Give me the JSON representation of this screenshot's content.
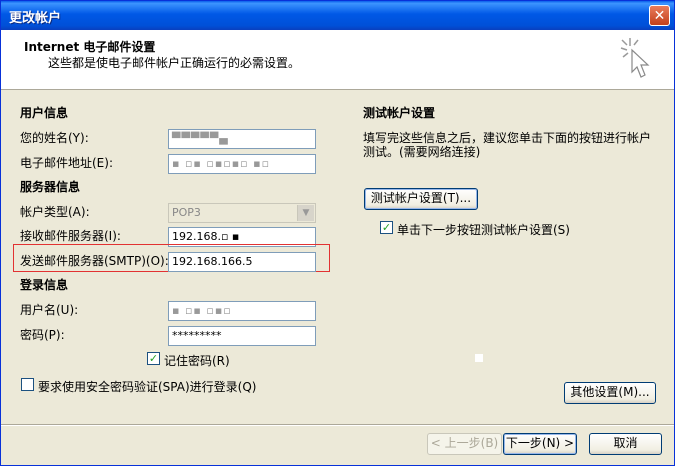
{
  "window": {
    "title": "更改帐户",
    "close_glyph": "✕"
  },
  "header": {
    "title": "Internet 电子邮件设置",
    "subtitle": "这些都是使电子邮件帐户正确运行的必需设置。"
  },
  "user_info": {
    "heading": "用户信息",
    "name_label": "您的姓名(Y):",
    "name_value": "▀▀▀▀▀▄",
    "email_label": "电子邮件地址(E):",
    "email_value": "▪ ▫▪  ▫▪▫▪▫ ▪▫"
  },
  "server_info": {
    "heading": "服务器信息",
    "account_type_label": "帐户类型(A):",
    "account_type_value": "POP3",
    "incoming_label": "接收邮件服务器(I):",
    "incoming_value": "192.168.▫ ▪",
    "outgoing_label": "发送邮件服务器(SMTP)(O):",
    "outgoing_value": "192.168.166.5"
  },
  "login_info": {
    "heading": "登录信息",
    "username_label": "用户名(U):",
    "username_value": "▪ ▫▪  ▫▪▫",
    "password_label": "密码(P):",
    "password_value": "*********",
    "remember_label": "记住密码(R)",
    "remember_checked": true,
    "spa_label": "要求使用安全密码验证(SPA)进行登录(Q)",
    "spa_checked": false
  },
  "test_settings": {
    "heading": "测试帐户设置",
    "description_line1": "填写完这些信息之后，建议您单击下面的按钮进行帐户",
    "description_line2": "测试。(需要网络连接)",
    "test_button": "测试帐户设置(T)...",
    "next_test_label": "单击下一步按钮测试帐户设置(S)",
    "next_test_checked": true
  },
  "buttons": {
    "more_settings": "其他设置(M)...",
    "back": "< 上一步(B)",
    "next": "下一步(N) >",
    "cancel": "取消"
  },
  "colors": {
    "titlebar": "#0058E6",
    "dialog_bg": "#ECE9D8",
    "highlight_border": "#E23232",
    "check": "#21A121"
  }
}
